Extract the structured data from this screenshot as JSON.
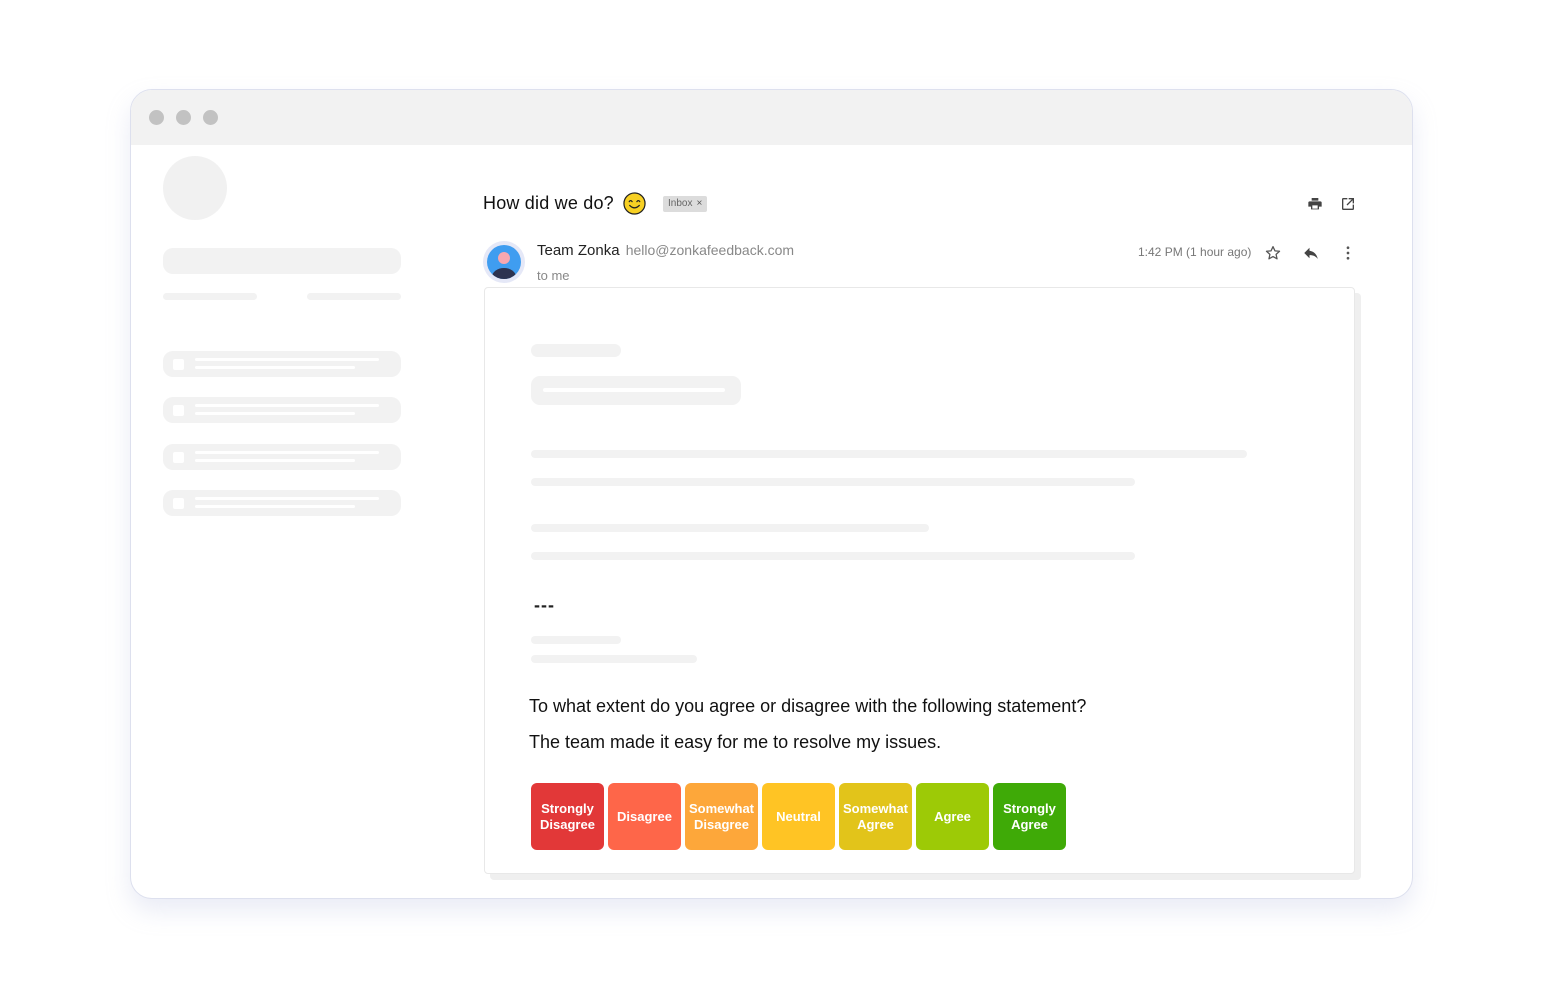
{
  "email": {
    "subject": "How did we do?",
    "label": "Inbox",
    "label_close": "×",
    "sender_name": "Team Zonka",
    "sender_email": "hello@zonkafeedback.com",
    "recipient": "to me",
    "time": "1:42 PM (1 hour ago)",
    "separator": "---",
    "question": "To what extent do you agree or disagree with the following statement?",
    "statement": "The team made it easy for me to resolve my issues.",
    "scale": [
      {
        "label": "Strongly Disagree",
        "color": "#e23838"
      },
      {
        "label": "Disagree",
        "color": "#fe6649"
      },
      {
        "label": "Somewhat Disagree",
        "color": "#fda73a"
      },
      {
        "label": "Neutral",
        "color": "#ffc424"
      },
      {
        "label": "Somewhat Agree",
        "color": "#e2c41a"
      },
      {
        "label": "Agree",
        "color": "#9dca06"
      },
      {
        "label": "Strongly Agree",
        "color": "#3faa07"
      }
    ]
  },
  "icons": {
    "print": "print-icon",
    "open_new": "open-in-new-icon",
    "star": "star-icon",
    "reply": "reply-icon",
    "more": "more-vertical-icon",
    "emoji": "smiling-face-icon"
  }
}
